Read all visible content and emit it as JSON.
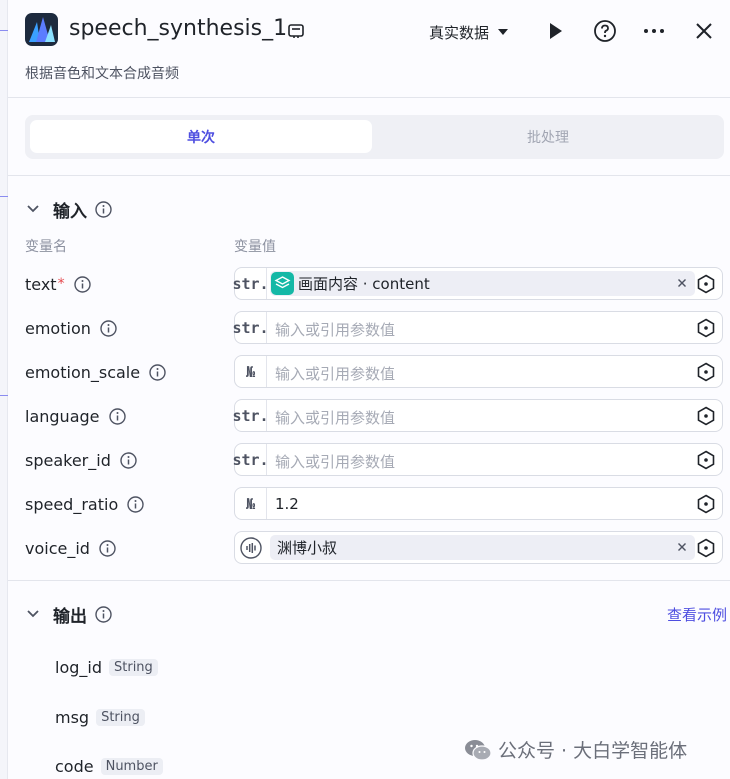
{
  "header": {
    "title": "speech_synthesis_1",
    "data_mode": "真实数据",
    "subtitle": "根据音色和文本合成音频"
  },
  "tabs": [
    {
      "label": "单次",
      "active": true
    },
    {
      "label": "批处理",
      "active": false
    }
  ],
  "input_section": {
    "title": "输入",
    "col_name": "变量名",
    "col_value": "变量值",
    "rows": [
      {
        "name": "text",
        "required_mark": "*",
        "type": "str.",
        "ref_label": "画面内容 · content"
      },
      {
        "name": "emotion",
        "type": "str.",
        "placeholder": "输入或引用参数值"
      },
      {
        "name": "emotion_scale",
        "type": "№",
        "placeholder": "输入或引用参数值"
      },
      {
        "name": "language",
        "type": "str.",
        "placeholder": "输入或引用参数值"
      },
      {
        "name": "speaker_id",
        "type": "str.",
        "placeholder": "输入或引用参数值"
      },
      {
        "name": "speed_ratio",
        "type": "№",
        "value": "1.2"
      },
      {
        "name": "voice_id",
        "voice_label": "渊博小叔"
      }
    ]
  },
  "output_section": {
    "title": "输出",
    "see_example": "查看示例",
    "items": [
      {
        "name": "log_id",
        "type": "String"
      },
      {
        "name": "msg",
        "type": "String"
      },
      {
        "name": "code",
        "type": "Number"
      }
    ]
  },
  "watermark": "公众号 · 大白学智能体",
  "colors": {
    "accent": "#4e4ee0",
    "required": "#e5484d",
    "ref_icon": "#14b8a6"
  },
  "icons": [
    "logo-icon",
    "edit-icon",
    "dropdown-caret-icon",
    "play-icon",
    "help-icon",
    "more-icon",
    "close-icon",
    "chevron-down-icon",
    "info-icon",
    "variable-ref-icon",
    "node-ref-icon",
    "clear-icon",
    "voice-wave-icon",
    "wechat-icon"
  ]
}
